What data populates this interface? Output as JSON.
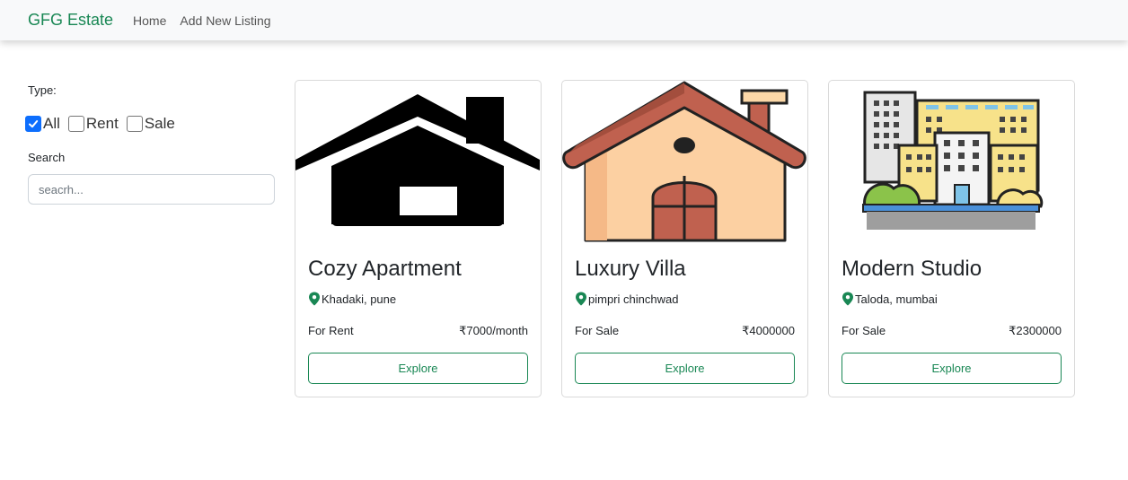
{
  "nav": {
    "brand": "GFG Estate",
    "links": [
      "Home",
      "Add New Listing"
    ]
  },
  "filters": {
    "type_label": "Type:",
    "options": [
      {
        "label": "All",
        "checked": true
      },
      {
        "label": "Rent",
        "checked": false
      },
      {
        "label": "Sale",
        "checked": false
      }
    ],
    "search_label": "Search",
    "search_placeholder": "seacrh..."
  },
  "listings": [
    {
      "title": "Cozy Apartment",
      "location": "Khadaki, pune",
      "status": "For Rent",
      "price": "₹7000/month",
      "button": "Explore",
      "icon": "house-black-icon"
    },
    {
      "title": "Luxury Villa",
      "location": "pimpri chinchwad",
      "status": "For Sale",
      "price": "₹4000000",
      "button": "Explore",
      "icon": "house-colored-icon"
    },
    {
      "title": "Modern Studio",
      "location": "Taloda, mumbai",
      "status": "For Sale",
      "price": "₹2300000",
      "button": "Explore",
      "icon": "city-buildings-icon"
    }
  ],
  "colors": {
    "accent": "#198754",
    "checkbox": "#0d6efd"
  }
}
